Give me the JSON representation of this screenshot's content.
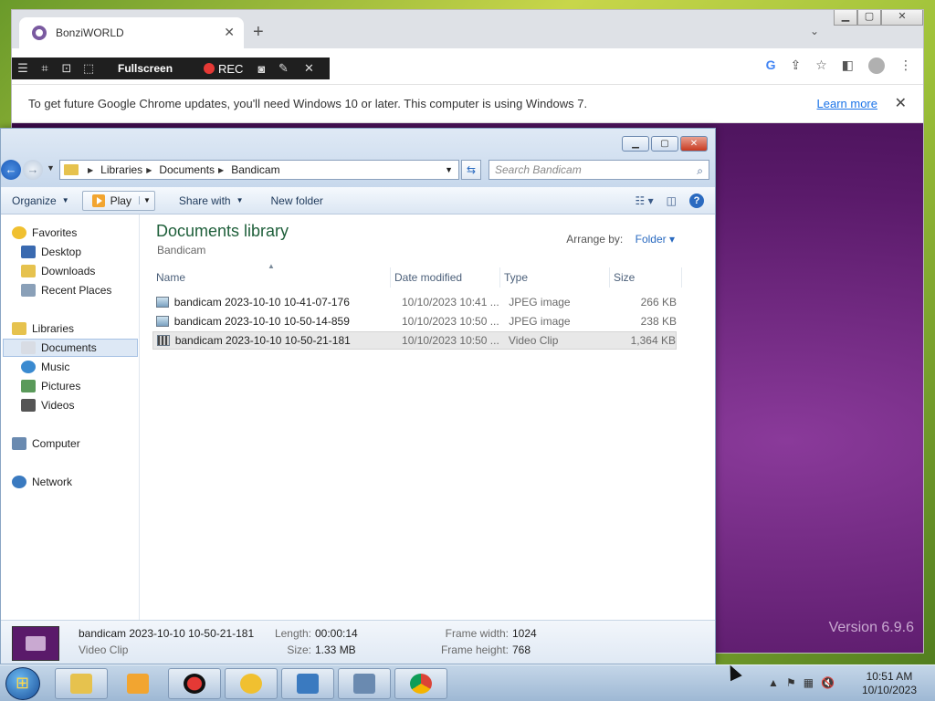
{
  "chrome": {
    "tab_title": "BonziWORLD",
    "tab_close": "✕",
    "new_tab": "+",
    "tab_search": "⌄",
    "win_min": "▁",
    "win_max": "▢",
    "win_close": "✕",
    "bandicam_bar": {
      "fullscreen_label": "Fullscreen",
      "rec_label": "REC"
    },
    "infobar": {
      "message": "To get future Google Chrome updates, you'll need Windows 10 or later. This computer is using Windows 7.",
      "link": "Learn more",
      "close": "✕"
    },
    "page": {
      "version": "Version 6.9.6"
    }
  },
  "explorer": {
    "address": {
      "crumbs": [
        "Libraries",
        "Documents",
        "Bandicam"
      ]
    },
    "search_placeholder": "Search Bandicam",
    "commands": {
      "organize": "Organize",
      "play": "Play",
      "share_with": "Share with",
      "new_folder": "New folder"
    },
    "nav": {
      "favorites": "Favorites",
      "desktop": "Desktop",
      "downloads": "Downloads",
      "recent_places": "Recent Places",
      "libraries": "Libraries",
      "documents": "Documents",
      "music": "Music",
      "pictures": "Pictures",
      "videos": "Videos",
      "computer": "Computer",
      "network": "Network"
    },
    "library": {
      "title": "Documents library",
      "subtitle": "Bandicam",
      "arrange_label": "Arrange by:",
      "arrange_value": "Folder"
    },
    "columns": {
      "name": "Name",
      "date": "Date modified",
      "type": "Type",
      "size": "Size"
    },
    "files": [
      {
        "name": "bandicam 2023-10-10 10-41-07-176",
        "date": "10/10/2023 10:41 ...",
        "type": "JPEG image",
        "size": "266 KB"
      },
      {
        "name": "bandicam 2023-10-10 10-50-14-859",
        "date": "10/10/2023 10:50 ...",
        "type": "JPEG image",
        "size": "238 KB"
      },
      {
        "name": "bandicam 2023-10-10 10-50-21-181",
        "date": "10/10/2023 10:50 ...",
        "type": "Video Clip",
        "size": "1,364 KB"
      }
    ],
    "details": {
      "name": "bandicam 2023-10-10 10-50-21-181",
      "type": "Video Clip",
      "length_label": "Length:",
      "length_value": "00:00:14",
      "size_label": "Size:",
      "size_value": "1.33 MB",
      "fw_label": "Frame width:",
      "fw_value": "1024",
      "fh_label": "Frame height:",
      "fh_value": "768"
    }
  },
  "taskbar": {
    "time": "10:51 AM",
    "date": "10/10/2023"
  }
}
